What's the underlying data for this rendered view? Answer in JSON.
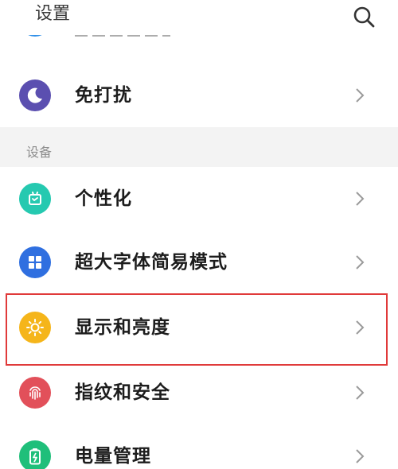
{
  "header": {
    "title": "设置",
    "search_icon": "search-icon"
  },
  "partial_item": {
    "icon": "blue-circle-icon",
    "icon_color": "#2f8fe8"
  },
  "items_top": [
    {
      "label": "免打扰",
      "icon": "moon-icon",
      "icon_color": "#5b4fb0"
    }
  ],
  "section": {
    "label": "设备"
  },
  "items_device": [
    {
      "label": "个性化",
      "icon": "personalize-icon",
      "icon_color": "#25c9b0"
    },
    {
      "label": "超大字体简易模式",
      "icon": "grid-icon",
      "icon_color": "#2f6fe0"
    },
    {
      "label": "显示和亮度",
      "icon": "sun-icon",
      "icon_color": "#f5b51a"
    },
    {
      "label": "指纹和安全",
      "icon": "fingerprint-icon",
      "icon_color": "#e2505a"
    },
    {
      "label": "电量管理",
      "icon": "battery-icon",
      "icon_color": "#1fbf7a"
    }
  ],
  "colors": {
    "highlight_border": "#e03a3a",
    "section_background": "#f3f3f3"
  }
}
